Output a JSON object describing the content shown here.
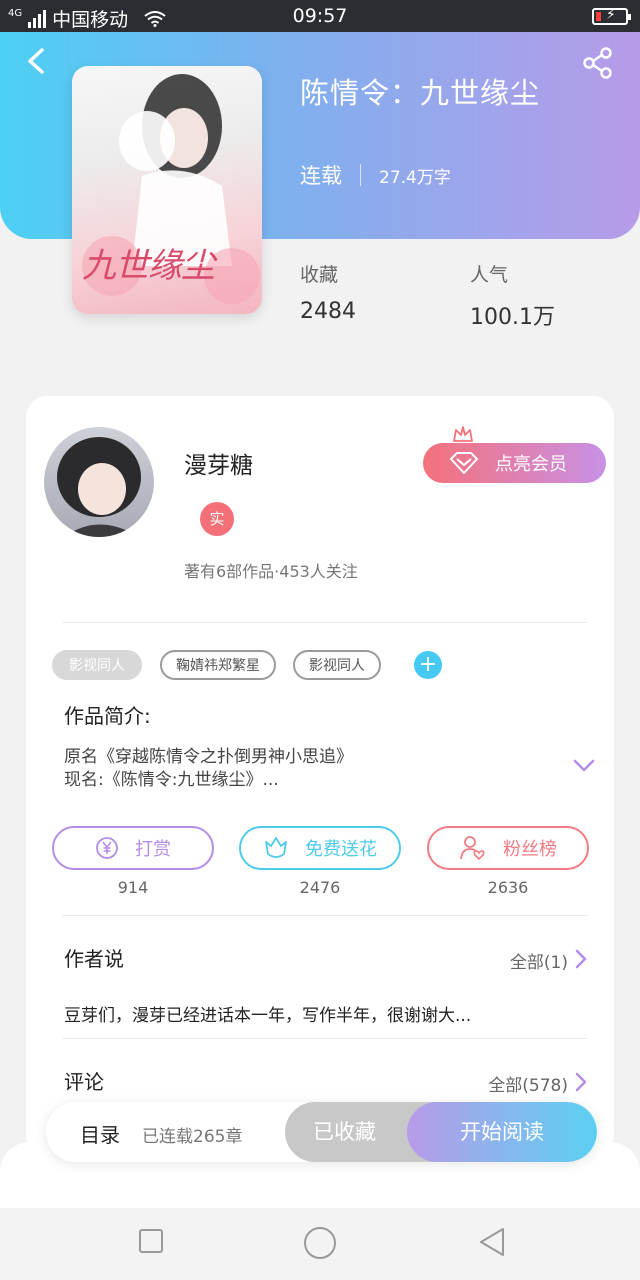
{
  "status_bar": {
    "network": "4G",
    "carrier": "中国移动",
    "time": "09:57"
  },
  "book": {
    "title": "陈情令：九世缘尘",
    "serial_status": "连载",
    "word_count": "27.4万字",
    "cover_text": "九世缘尘"
  },
  "stats": {
    "favorites_label": "收藏",
    "favorites_value": "2484",
    "popularity_label": "人气",
    "popularity_value": "100.1万"
  },
  "author": {
    "name": "漫芽糖",
    "badge": "实",
    "meta": "著有6部作品·453人关注",
    "vip_button": "点亮会员"
  },
  "tags": [
    "影视同人",
    "鞠婧祎郑繁星",
    "影视同人"
  ],
  "intro": {
    "title": "作品简介:",
    "line1": "原名《穿越陈情令之扑倒男神小思追》",
    "line2": "现名:《陈情令:九世缘尘》..."
  },
  "actions": {
    "reward_label": "打赏",
    "reward_count": "914",
    "flower_label": "免费送花",
    "flower_count": "2476",
    "fans_label": "粉丝榜",
    "fans_count": "2636"
  },
  "author_says": {
    "title": "作者说",
    "more": "全部(1)",
    "text": "豆芽们，漫芽已经进话本一年，写作半年，很谢谢大..."
  },
  "comments": {
    "title": "评论",
    "more": "全部(578)"
  },
  "bottom_bar": {
    "toc_label": "目录",
    "toc_count": "已连载265章",
    "collected_label": "已收藏",
    "read_label": "开始阅读"
  },
  "colors": {
    "header_gradient_start": "#4cd0f3",
    "header_gradient_end": "#b79be9",
    "reward": "#b48de6",
    "flower": "#4fcbe9",
    "fans": "#f27b83",
    "vip_start": "#f4717a",
    "vip_end": "#c891e6"
  }
}
